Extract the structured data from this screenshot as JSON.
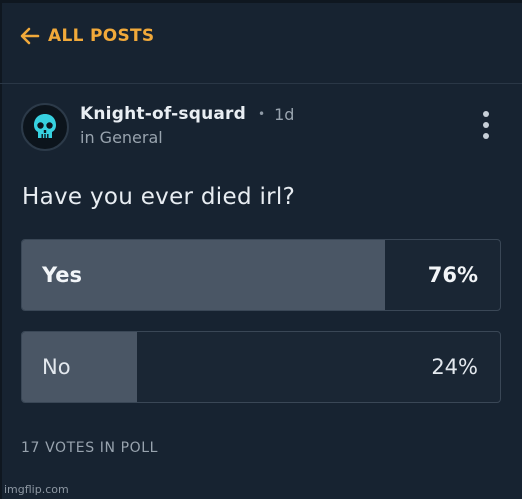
{
  "nav": {
    "back_label": "ALL POSTS"
  },
  "post": {
    "author": "Knight-of-squard",
    "separator": "•",
    "age": "1d",
    "community": "in General",
    "question": "Have you ever died irl?"
  },
  "poll": {
    "options": [
      {
        "label": "Yes",
        "percent_text": "76%",
        "percent": 76
      },
      {
        "label": "No",
        "percent_text": "24%",
        "percent": 24
      }
    ],
    "votes_text": "17 VOTES IN POLL"
  },
  "watermark": "imgflip.com",
  "colors": {
    "background": "#172331",
    "accent": "#f1a93a",
    "poll_fill": "#4a5665",
    "skull": "#37d1e0"
  },
  "icons": {
    "back": "arrow-left-icon",
    "avatar": "skull-icon",
    "menu": "kebab-menu-icon"
  }
}
